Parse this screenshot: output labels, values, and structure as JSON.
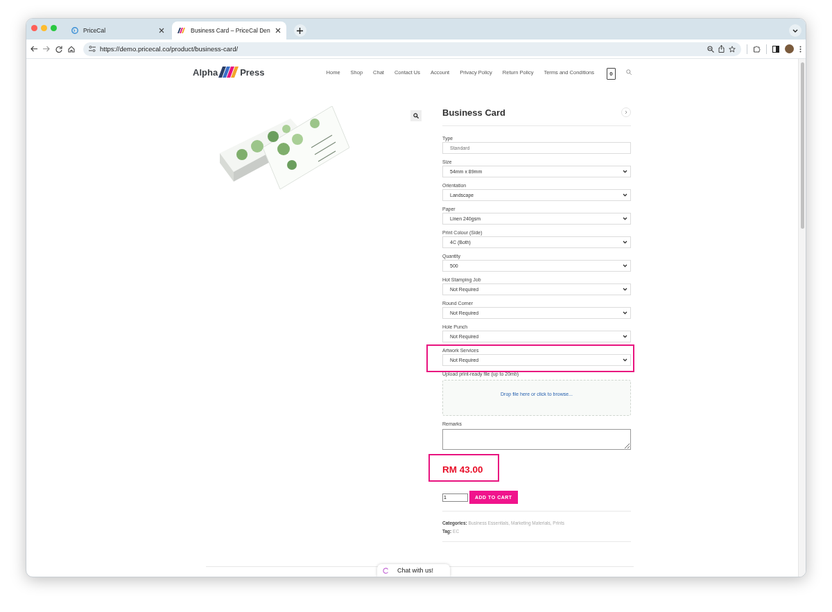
{
  "browser": {
    "tabs": [
      {
        "title": "PriceCal",
        "selected": false
      },
      {
        "title": "Business Card – PriceCal Den",
        "selected": true
      }
    ],
    "url": "https://demo.pricecal.co/product/business-card/"
  },
  "site": {
    "logo": {
      "left": "Alpha",
      "right": "Press"
    },
    "nav": [
      "Home",
      "Shop",
      "Chat",
      "Contact Us",
      "Account",
      "Privacy Policy",
      "Return Policy",
      "Terms and Conditions"
    ],
    "cart_count": "0"
  },
  "product": {
    "title": "Business Card",
    "fields": [
      {
        "kind": "text",
        "label": "Type",
        "placeholder": "Standard",
        "highlighted": false
      },
      {
        "kind": "select",
        "label": "Size",
        "value": "54mm x 89mm",
        "highlighted": false
      },
      {
        "kind": "select",
        "label": "Orientation",
        "value": "Landscape",
        "highlighted": false
      },
      {
        "kind": "select",
        "label": "Paper",
        "value": "Linen 240gsm",
        "highlighted": false
      },
      {
        "kind": "select",
        "label": "Print Colour (Side)",
        "value": "4C (Both)",
        "highlighted": false
      },
      {
        "kind": "select",
        "label": "Quantity",
        "value": "500",
        "highlighted": false
      },
      {
        "kind": "select",
        "label": "Hot Stamping Job",
        "value": "Not Required",
        "highlighted": false
      },
      {
        "kind": "select",
        "label": "Round Corner",
        "value": "Not Required",
        "highlighted": false
      },
      {
        "kind": "select",
        "label": "Hole Punch",
        "value": "Not Required",
        "highlighted": false
      },
      {
        "kind": "select",
        "label": "Artwork Services",
        "value": "Not Required",
        "highlighted": true
      },
      {
        "kind": "upload",
        "label": "Upload print-ready file (up to 20mb)",
        "value": "Drop file here or click to browse...",
        "highlighted": false
      },
      {
        "kind": "textarea",
        "label": "Remarks",
        "highlighted": false
      }
    ],
    "price": {
      "text": "RM 43.00",
      "highlighted": true
    },
    "quantity": "1",
    "add_to_cart": "ADD TO CART",
    "categories": {
      "label": "Categories:",
      "separator": ",",
      "items": [
        "Business Essentials",
        "Marketing Materials",
        "Prints"
      ]
    },
    "tag": {
      "label": "Tag:",
      "items": [
        "EC"
      ]
    }
  },
  "chat": {
    "label": "Chat with us!"
  }
}
